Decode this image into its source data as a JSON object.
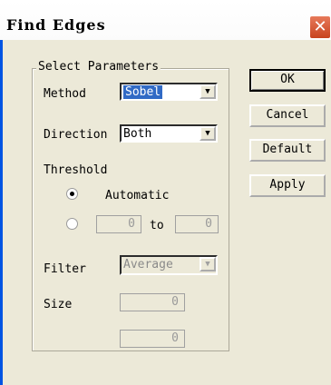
{
  "window": {
    "title": "Find Edges",
    "close_glyph": "✕"
  },
  "group": {
    "legend": "Select Parameters"
  },
  "method": {
    "label": "Method",
    "value": "Sobel"
  },
  "direction": {
    "label": "Direction",
    "value": "Both"
  },
  "threshold": {
    "label": "Threshold",
    "automatic_label": "Automatic",
    "selected": "Automatic",
    "min_value": "0",
    "to_label": "to",
    "max_value": "0"
  },
  "filter": {
    "label": "Filter",
    "value": "Average"
  },
  "size": {
    "label": "Size",
    "value1": "0",
    "value2": "0"
  },
  "buttons": {
    "ok": "OK",
    "cancel": "Cancel",
    "default": "Default",
    "apply": "Apply"
  }
}
